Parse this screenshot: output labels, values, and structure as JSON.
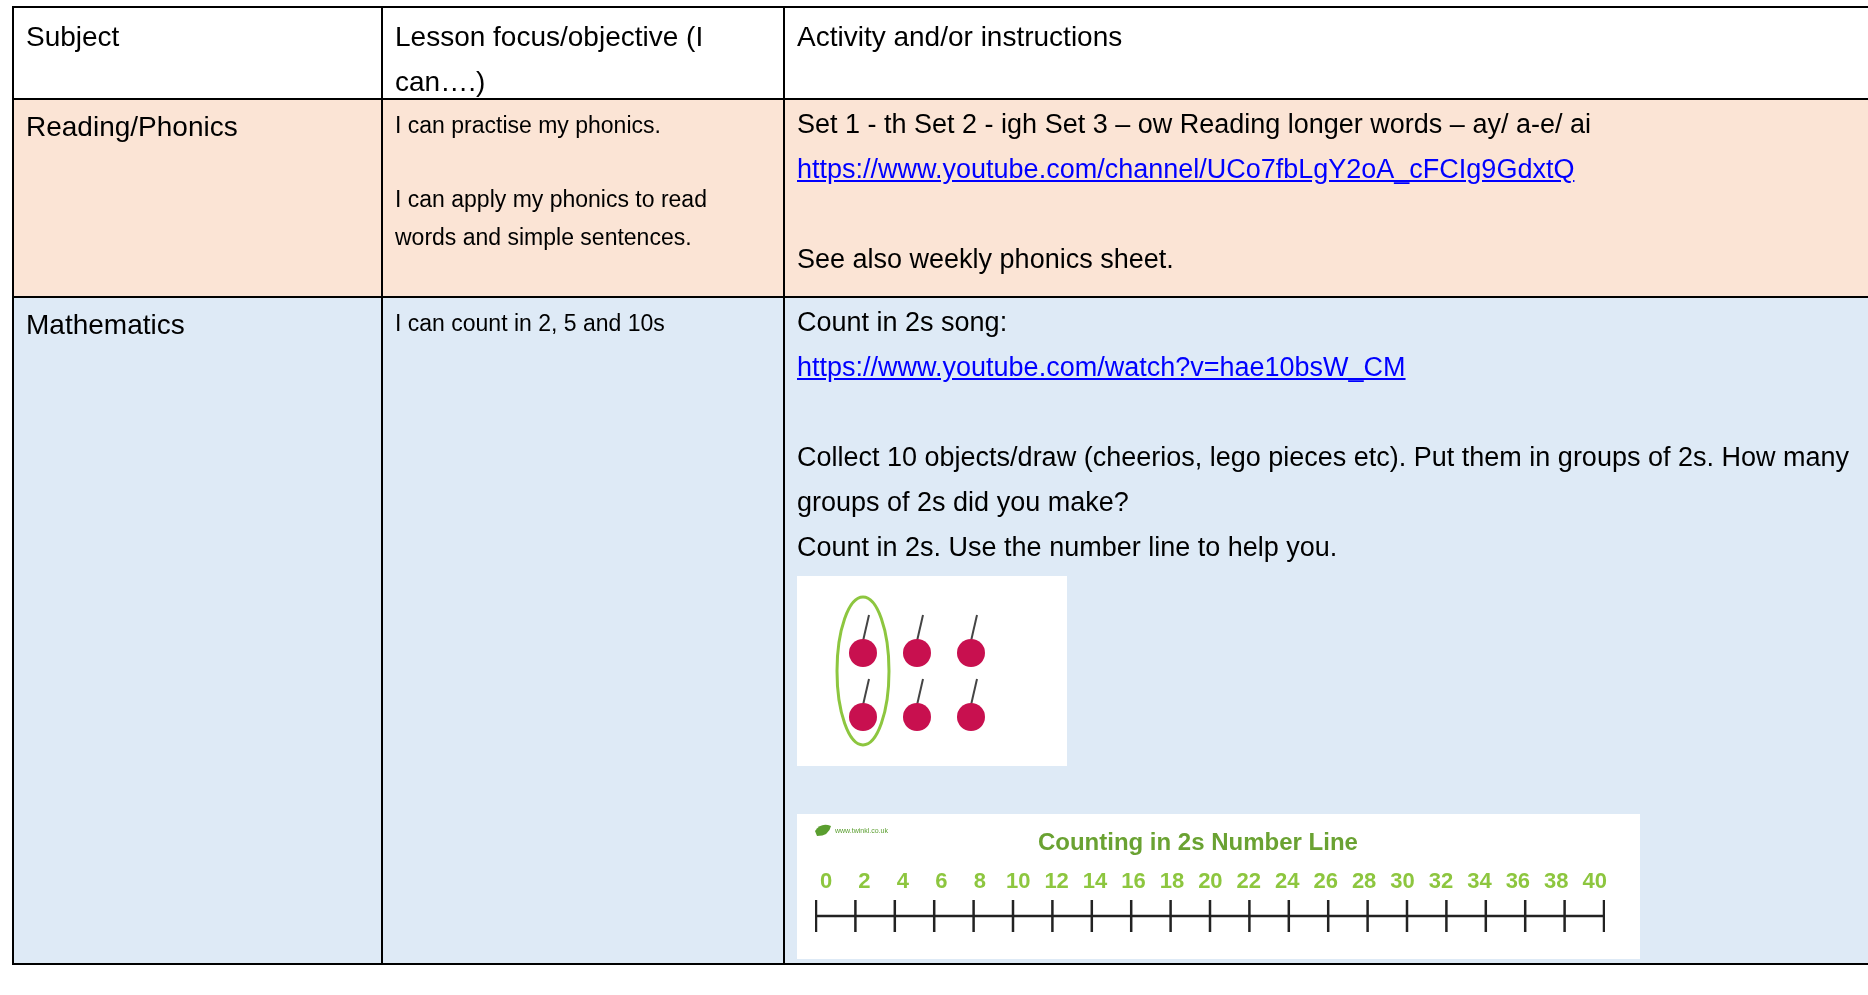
{
  "table": {
    "columns": [
      "Subject",
      "Lesson focus/objective (I can….)",
      "Activity and/or instructions"
    ],
    "rows": [
      {
        "subject": "Reading/Phonics",
        "color": "#fbe4d5",
        "objectives": [
          "I can practise my phonics.",
          "I can apply my phonics to read words and simple sentences."
        ],
        "activity": [
          {
            "kind": "text",
            "text": "Set 1 - th Set 2 - igh Set 3 – ow Reading longer words – ay/ a-e/ ai",
            "spaced": false
          },
          {
            "kind": "link",
            "text": "https://www.youtube.com/channel/UCo7fbLgY2oA_cFCIg9GdxtQ",
            "spaced": false
          },
          {
            "kind": "text",
            "text": "See also weekly phonics sheet.",
            "spaced": true
          }
        ]
      },
      {
        "subject": "Mathematics",
        "color": "#deeaf6",
        "objectives": [
          "I can count in 2, 5 and 10s"
        ],
        "activity": [
          {
            "kind": "text",
            "text": "Count in 2s song:",
            "spaced": false
          },
          {
            "kind": "link",
            "text": "https://www.youtube.com/watch?v=hae10bsW_CM",
            "spaced": false
          },
          {
            "kind": "text",
            "text": "Collect 10 objects/draw (cheerios, lego pieces etc). Put them in groups of 2s. How many groups of 2s did you make?",
            "spaced": true
          },
          {
            "kind": "text",
            "text": "Count in 2s. Use the number line to help you.",
            "spaced": false
          },
          {
            "kind": "cherries"
          },
          {
            "kind": "number_line",
            "site": "www.twinkl.co.uk",
            "title": "Counting in 2s Number Line",
            "numbers": [
              "0",
              "2",
              "4",
              "6",
              "8",
              "10",
              "12",
              "14",
              "16",
              "18",
              "20",
              "22",
              "24",
              "26",
              "28",
              "30",
              "32",
              "34",
              "36",
              "38",
              "40"
            ]
          }
        ]
      }
    ]
  }
}
